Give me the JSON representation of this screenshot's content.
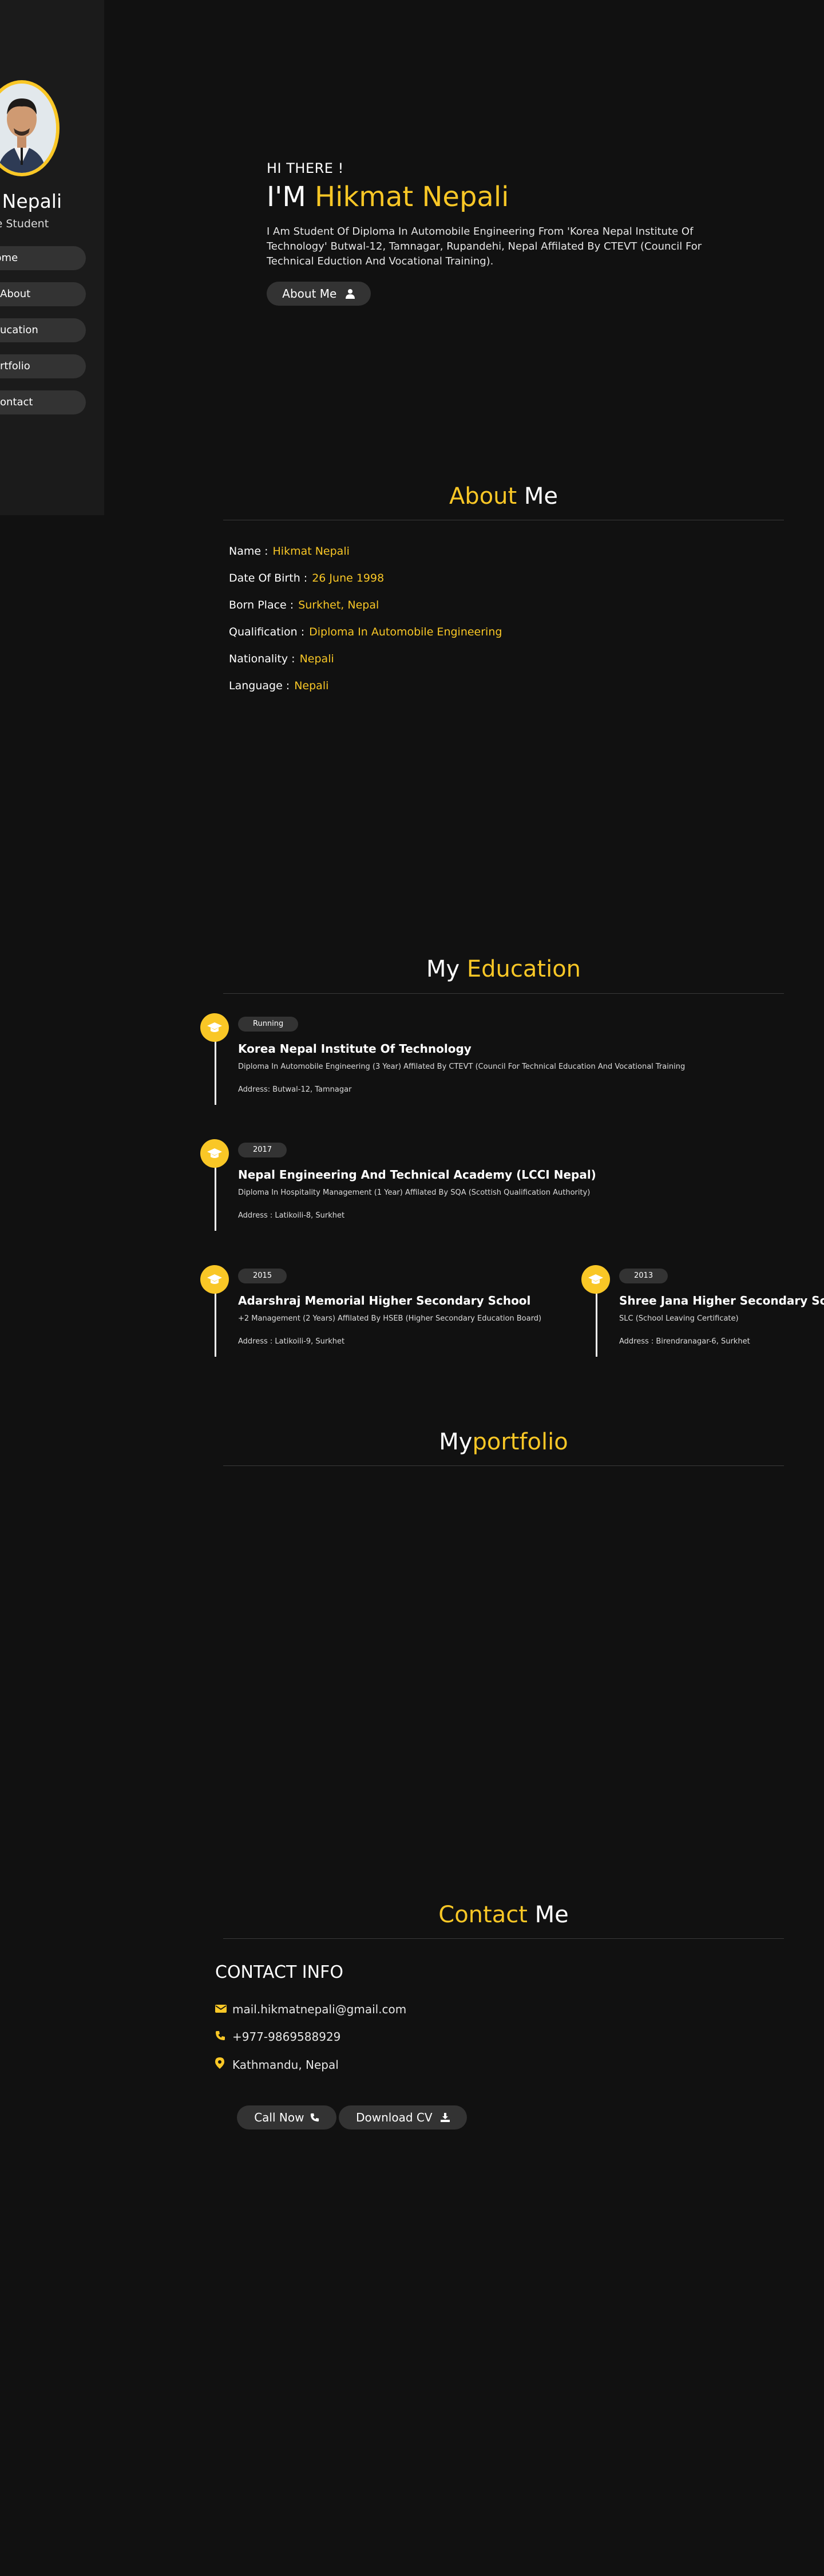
{
  "sidebar": {
    "name": "Hikmat Nepali",
    "name_visible": "at Nepali",
    "role_visible": "bile Student",
    "nav": [
      {
        "label": "Home",
        "visible": "Home"
      },
      {
        "label": "About",
        "visible": "About"
      },
      {
        "label": "Education",
        "visible": "ucation"
      },
      {
        "label": "Portfolio",
        "visible": "rtfolio"
      },
      {
        "label": "Contact",
        "visible": "ontact"
      }
    ]
  },
  "hero": {
    "greeting": "HI THERE !",
    "im_prefix": "I'M",
    "name": "Hikmat Nepali",
    "description": "I Am Student Of Diploma In Automobile Engineering From 'Korea Nepal Institute Of Technology' Butwal-12, Tamnagar, Rupandehi, Nepal Affilated By CTEVT (Council For Technical Eduction And Vocational Training).",
    "about_button": "About Me"
  },
  "about": {
    "title_hl": "About",
    "title_rest": "Me",
    "rows": [
      {
        "label": "Name :",
        "value": "Hikmat Nepali"
      },
      {
        "label": "Date Of Birth :",
        "value": "26 June 1998"
      },
      {
        "label": "Born Place :",
        "value": "Surkhet, Nepal"
      },
      {
        "label": "Qualification :",
        "value": "Diploma In Automobile Engineering"
      },
      {
        "label": "Nationality :",
        "value": "Nepali"
      },
      {
        "label": "Language :",
        "value": "Nepali"
      }
    ]
  },
  "education": {
    "title_rest": "My",
    "title_hl": "Education",
    "items": [
      {
        "badge": "Running",
        "institution": "Korea Nepal Institute Of Technology",
        "details": "Diploma In Automobile Engineering (3 Year) Affilated By CTEVT (Council For Technical Education And Vocational Training",
        "address": "Address: Butwal-12, Tamnagar"
      },
      {
        "badge": "2017",
        "institution": "Nepal Engineering And Technical Academy (LCCI Nepal)",
        "details": "Diploma In Hospitality Management (1 Year) Affilated By SQA (Scottish Qualification Authority)",
        "address": "Address : Latikoili-8, Surkhet"
      },
      {
        "badge": "2015",
        "institution": "Adarshraj Memorial Higher Secondary School",
        "details": "+2 Management (2 Years) Affilated By HSEB (Higher Secondary Education Board)",
        "address": "Address : Latikoili-9, Surkhet"
      },
      {
        "badge": "2013",
        "institution": "Shree Jana Higher Secondary School",
        "details": "SLC (School Leaving Certificate)",
        "address": "Address : Birendranagar-6, Surkhet"
      }
    ]
  },
  "portfolio": {
    "title_rest": "My",
    "title_hl": "portfolio"
  },
  "contact": {
    "title_hl": "Contact",
    "title_rest": "Me",
    "info_title": "CONTACT INFO",
    "email": "mail.hikmatnepali@gmail.com",
    "phone": "+977-9869588929",
    "location": "Kathmandu, Nepal",
    "call_button": "Call Now",
    "cv_button": "Download CV"
  },
  "colors": {
    "background": "#111111",
    "sidebar": "#1b1b1b",
    "accent": "#f9c726",
    "button": "#333333"
  },
  "icons": [
    "user-icon",
    "graduation-cap-icon",
    "envelope-icon",
    "phone-icon",
    "map-marker-icon",
    "download-icon"
  ]
}
